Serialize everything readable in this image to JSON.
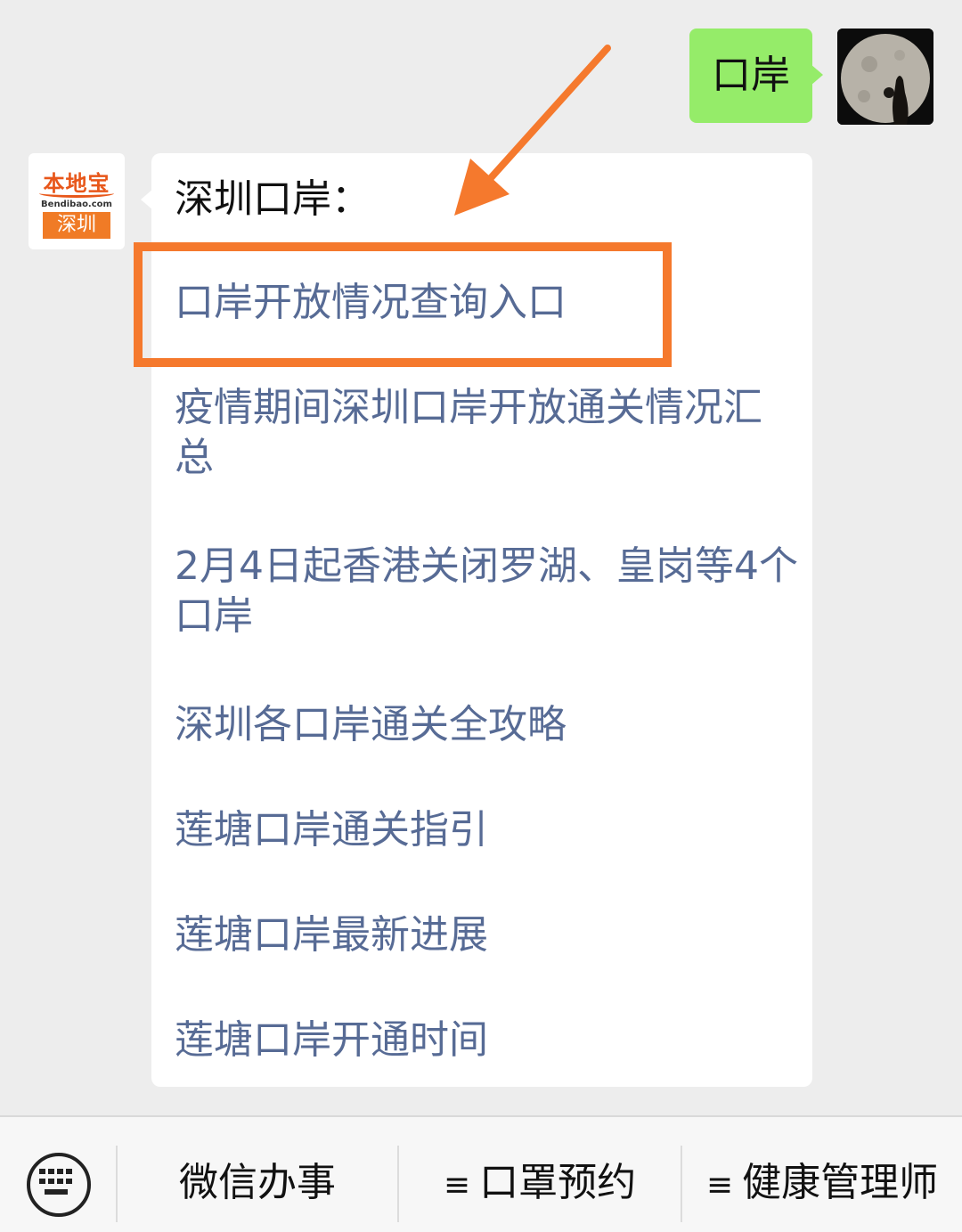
{
  "outgoing": {
    "text": "口岸"
  },
  "bot_logo": {
    "brand": "本地宝",
    "url": "Bendibao.com",
    "city": "深圳"
  },
  "reply": {
    "title": "深圳口岸：",
    "links": [
      "口岸开放情况查询入口",
      "疫情期间深圳口岸开放通关情况汇总",
      "2月4日起香港关闭罗湖、皇岗等4个口岸",
      "深圳各口岸通关全攻略",
      "莲塘口岸通关指引",
      "莲塘口岸最新进展",
      "莲塘口岸开通时间"
    ]
  },
  "menu": {
    "items": [
      {
        "label": "微信办事",
        "has_submenu": false
      },
      {
        "label": "口罩预约",
        "has_submenu": true
      },
      {
        "label": "健康管理师",
        "has_submenu": true
      }
    ],
    "submenu_glyph": "≡"
  },
  "colors": {
    "link": "#576b95",
    "outgoing_bubble": "#95ec69",
    "annotation": "#f5792d",
    "background": "#ededed"
  }
}
